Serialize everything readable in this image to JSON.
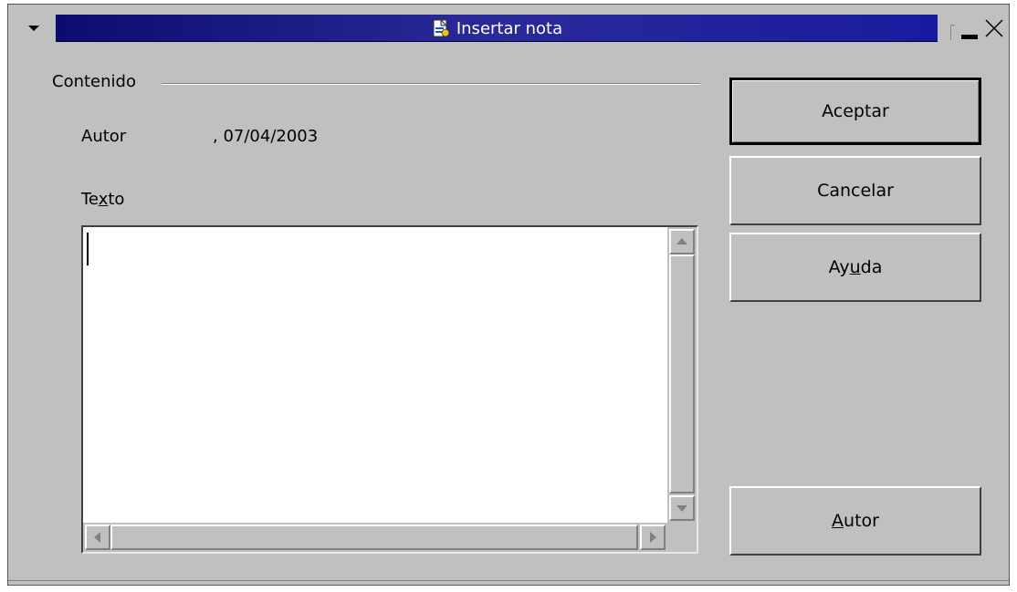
{
  "window": {
    "title": "Insertar nota",
    "icons": {
      "menu": "window-menu-arrow-icon",
      "app": "note-document-icon",
      "minimize": "minimize-icon",
      "close": "close-icon"
    }
  },
  "content": {
    "group_label": "Contenido",
    "author_label": "Autor",
    "author_value": ", 07/04/2003",
    "text_label_pre": "Te",
    "text_label_mnemonic": "x",
    "text_label_post": "to",
    "text_value": ""
  },
  "buttons": {
    "ok": "Aceptar",
    "cancel": "Cancelar",
    "help_pre": "Ay",
    "help_mnemonic": "u",
    "help_post": "da",
    "author_mnemonic": "A",
    "author_post": "utor"
  },
  "colors": {
    "title_gradient_start": "#0c0c70",
    "title_gradient_end": "#1a1aa0",
    "dialog_background": "#c0c0c0"
  }
}
